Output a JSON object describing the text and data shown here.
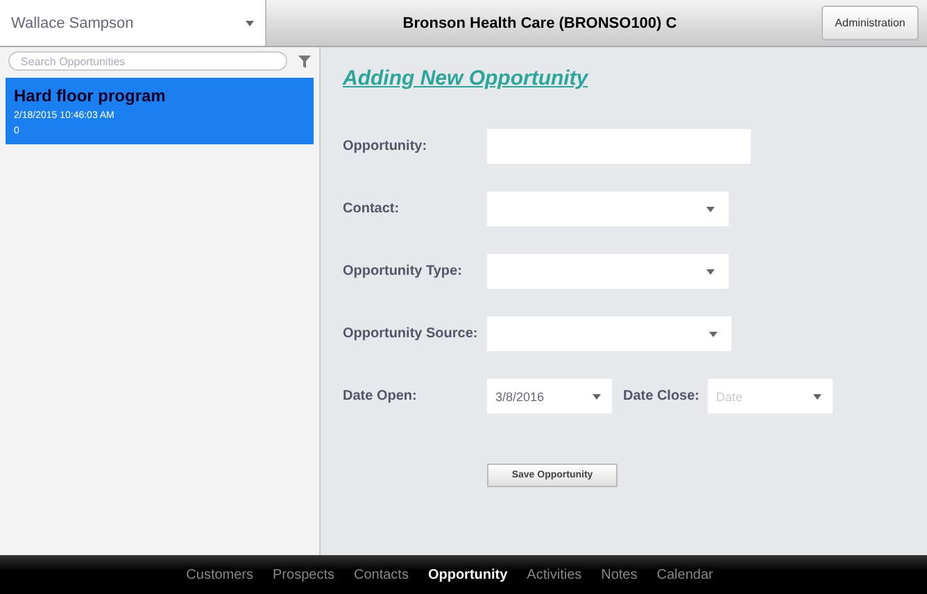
{
  "top_bar": {
    "user_select": "Wallace Sampson",
    "title": "Bronson Health Care (BRONSO100) C",
    "admin_button": "Administration"
  },
  "sidebar": {
    "search": {
      "placeholder": "Search Opportunities"
    },
    "items": [
      {
        "title": "Hard floor program",
        "subtitle": "2/18/2015 10:46:03 AM",
        "count": "0",
        "selected": true
      }
    ]
  },
  "form": {
    "heading": "Adding New Opportunity",
    "fields": [
      {
        "label": "Opportunity:",
        "kind": "text"
      },
      {
        "label": "Contact:",
        "kind": "select"
      },
      {
        "label": "Opportunity Type:",
        "kind": "select"
      },
      {
        "label": "Opportunity Source:",
        "kind": "select"
      }
    ],
    "date_open": {
      "label": "Date Open:",
      "value": "3/8/2016"
    },
    "date_close": {
      "label": "Date Close:",
      "placeholder": "Date"
    },
    "save_button": "Save Opportunity"
  },
  "tab_bar": [
    {
      "label": "Customers",
      "selected": false
    },
    {
      "label": "Prospects",
      "selected": false
    },
    {
      "label": "Contacts",
      "selected": false
    },
    {
      "label": "Opportunity",
      "selected": true
    },
    {
      "label": "Activities",
      "selected": false
    },
    {
      "label": "Notes",
      "selected": false
    },
    {
      "label": "Calendar",
      "selected": false
    }
  ]
}
